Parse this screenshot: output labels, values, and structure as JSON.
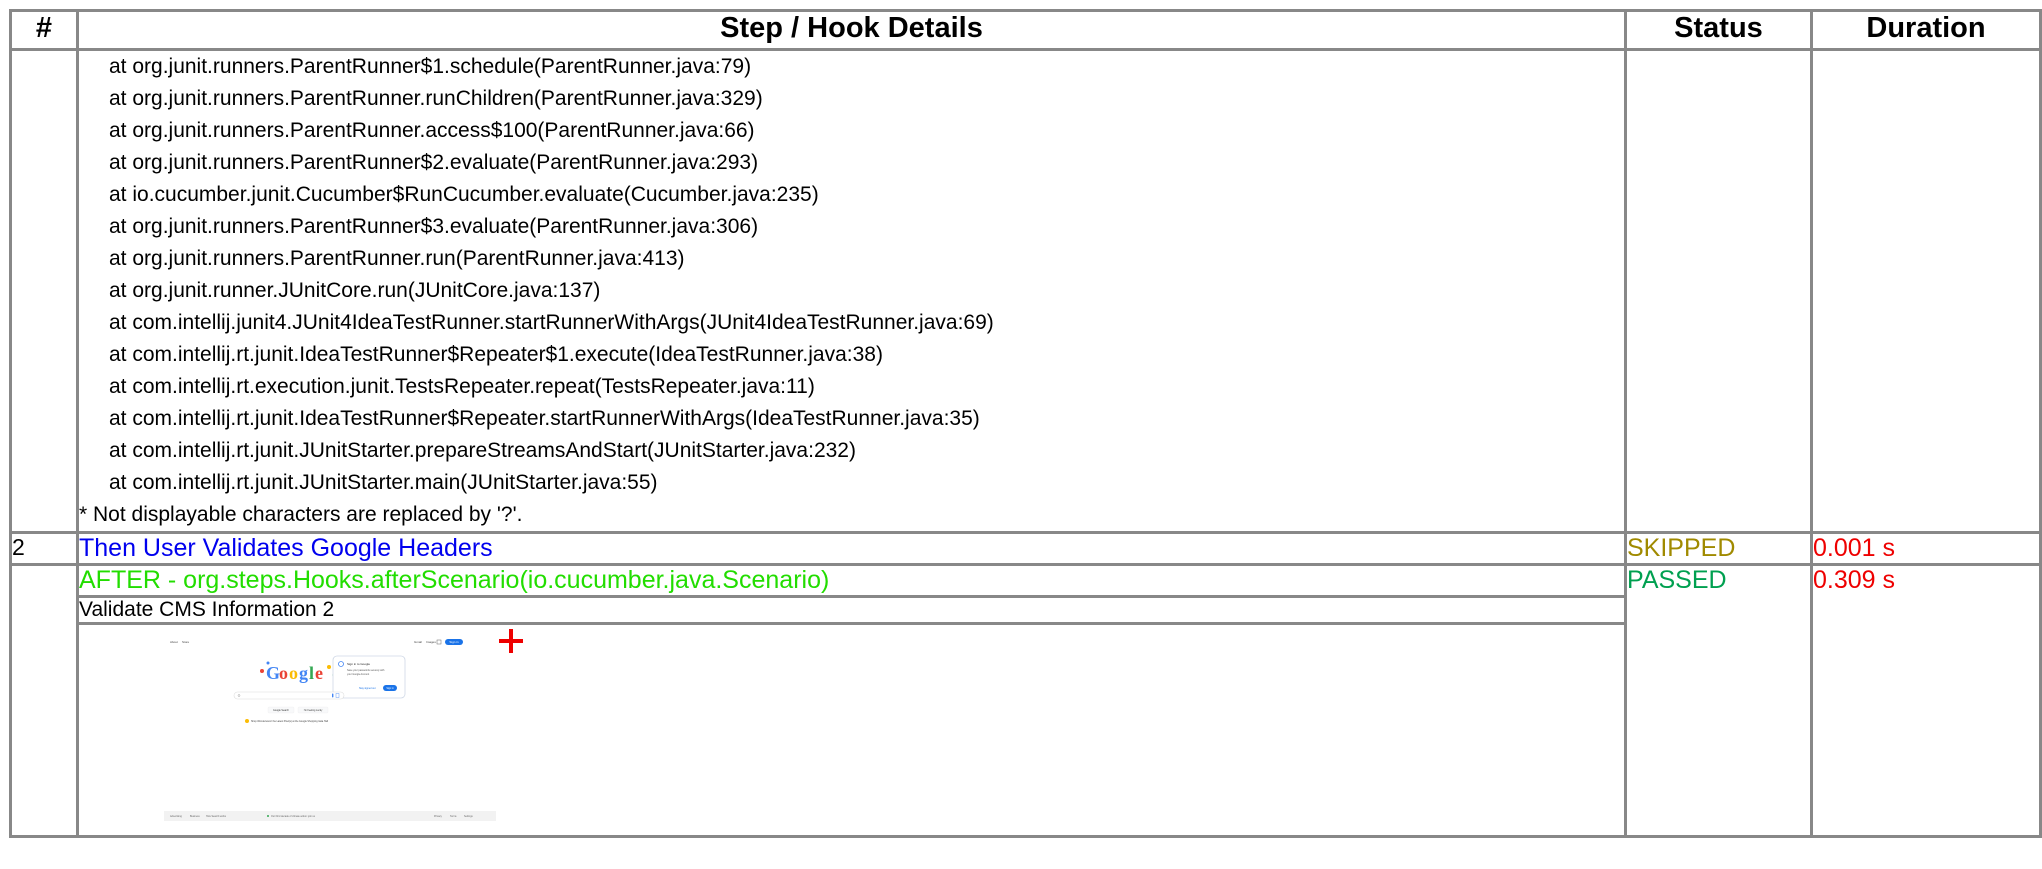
{
  "header": {
    "num": "#",
    "details": "Step / Hook Details",
    "status": "Status",
    "duration": "Duration"
  },
  "trace": {
    "frames": [
      "at org.junit.runners.ParentRunner$1.schedule(ParentRunner.java:79)",
      "at org.junit.runners.ParentRunner.runChildren(ParentRunner.java:329)",
      "at org.junit.runners.ParentRunner.access$100(ParentRunner.java:66)",
      "at org.junit.runners.ParentRunner$2.evaluate(ParentRunner.java:293)",
      "at io.cucumber.junit.Cucumber$RunCucumber.evaluate(Cucumber.java:235)",
      "at org.junit.runners.ParentRunner$3.evaluate(ParentRunner.java:306)",
      "at org.junit.runners.ParentRunner.run(ParentRunner.java:413)",
      "at org.junit.runner.JUnitCore.run(JUnitCore.java:137)",
      "at com.intellij.junit4.JUnit4IdeaTestRunner.startRunnerWithArgs(JUnit4IdeaTestRunner.java:69)",
      "at com.intellij.rt.junit.IdeaTestRunner$Repeater$1.execute(IdeaTestRunner.java:38)",
      "at com.intellij.rt.execution.junit.TestsRepeater.repeat(TestsRepeater.java:11)",
      "at com.intellij.rt.junit.IdeaTestRunner$Repeater.startRunnerWithArgs(IdeaTestRunner.java:35)",
      "at com.intellij.rt.junit.JUnitStarter.prepareStreamsAndStart(JUnitStarter.java:232)",
      "at com.intellij.rt.junit.JUnitStarter.main(JUnitStarter.java:55)"
    ],
    "note": "* Not displayable characters are replaced by '?'."
  },
  "step2": {
    "num": "2",
    "text": "Then User Validates Google Headers",
    "status": "SKIPPED",
    "duration": "0.001 s"
  },
  "hook": {
    "text": "AFTER - org.steps.Hooks.afterScenario(io.cucumber.java.Scenario)",
    "status": "PASSED",
    "duration": "0.309 s",
    "attachment_title": "Validate CMS Information 2"
  },
  "thumbnail": {
    "logo_letters": [
      "G",
      "o",
      "o",
      "g",
      "l",
      "e"
    ],
    "top_left": [
      "About",
      "Store"
    ],
    "top_right": [
      "Gmail",
      "Images"
    ],
    "sign_in_button": "Sign in",
    "popup_title": "Sign in to Google",
    "popup_body_1": "Save your passwords securely with",
    "popup_body_2": "your Google Account",
    "popup_stay_signed_out": "Stay signed out",
    "popup_sign_in": "Sign in",
    "btn_search": "Google Search",
    "btn_lucky": "I'm Feeling Lucky",
    "promo": "Shop Wonderwood: the Latest Pixel(s) at the Google Shopping Gala Hall",
    "footer_left": [
      "Advertising",
      "Business",
      "How Search works"
    ],
    "footer_center": "Our third decade of climate action: join us",
    "footer_right": [
      "Privacy",
      "Terms",
      "Settings"
    ],
    "colors": {
      "blue": "#4285f4",
      "red": "#ea4335",
      "yellow": "#fbbc05",
      "green": "#34a853"
    }
  }
}
